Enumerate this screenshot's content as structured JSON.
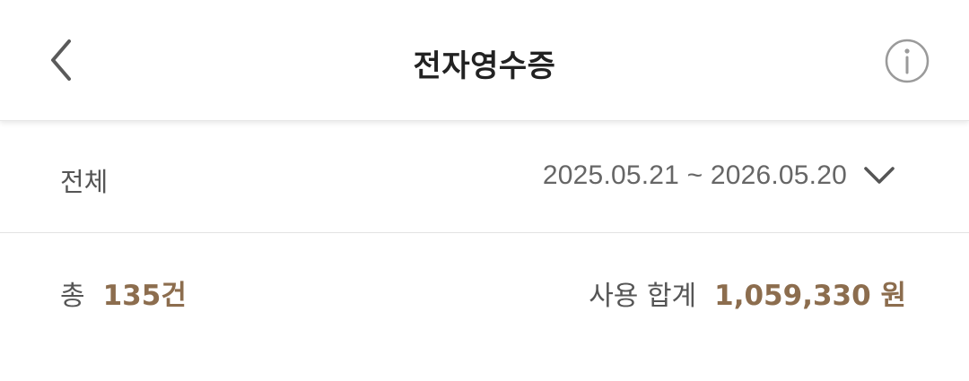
{
  "header": {
    "title": "전자영수증",
    "back_icon": "chevron-left-icon",
    "info_icon": "info-circle-icon"
  },
  "filter": {
    "category": "전체",
    "date_range": "2025.05.21 ~ 2026.05.20",
    "dropdown_icon": "chevron-down-icon"
  },
  "summary": {
    "total_label": "총",
    "total_count": "135건",
    "sum_label": "사용 합계",
    "sum_amount": "1,059,330 원"
  },
  "colors": {
    "accent": "#8c6d4e",
    "text_primary": "#222222",
    "text_secondary": "#555555",
    "divider": "#e3e3e3"
  }
}
